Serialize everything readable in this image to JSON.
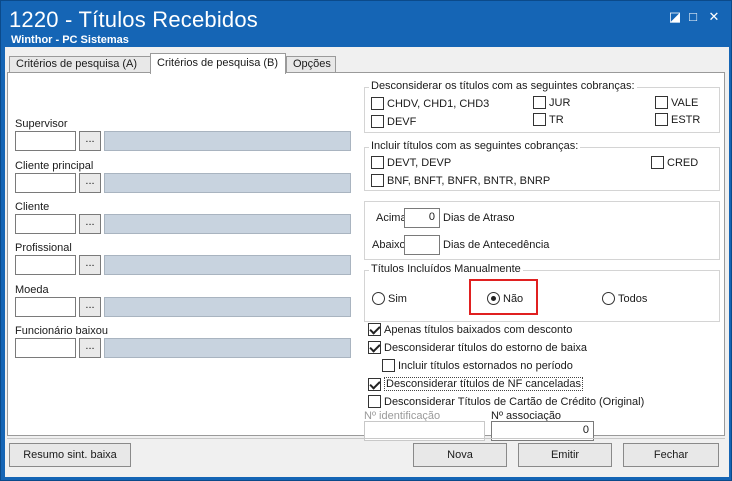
{
  "window": {
    "title": "1220 - Títulos Recebidos",
    "subtitle": "Winthor - PC Sistemas",
    "controls": {
      "restore": "◪",
      "maximize": "□",
      "close": "✕"
    }
  },
  "tabs": [
    {
      "label": "Critérios de pesquisa (A)",
      "active": false
    },
    {
      "label": "Critérios de pesquisa (B)",
      "active": true
    },
    {
      "label": "Opções",
      "active": false
    }
  ],
  "left_fields": {
    "supervisor": {
      "label": "Supervisor",
      "value": "",
      "button": "..."
    },
    "cliente_principal": {
      "label": "Cliente principal",
      "value": "",
      "button": "..."
    },
    "cliente": {
      "label": "Cliente",
      "value": "",
      "button": "..."
    },
    "profissional": {
      "label": "Profissional",
      "value": "",
      "button": "..."
    },
    "moeda": {
      "label": "Moeda",
      "value": "",
      "button": "..."
    },
    "funcionario_baixou": {
      "label": "Funcionário baixou",
      "value": "",
      "button": "..."
    }
  },
  "desconsiderar_cobrancas": {
    "title": "Desconsiderar os títulos com as seguintes cobranças:",
    "items": [
      {
        "label": "CHDV, CHD1, CHD3",
        "checked": false
      },
      {
        "label": "JUR",
        "checked": false
      },
      {
        "label": "VALE",
        "checked": false
      },
      {
        "label": "DEVF",
        "checked": false
      },
      {
        "label": "TR",
        "checked": false
      },
      {
        "label": "ESTR",
        "checked": false
      }
    ]
  },
  "incluir_cobrancas": {
    "title": "Incluir títulos com as seguintes cobranças:",
    "items": [
      {
        "label": "DEVT, DEVP",
        "checked": false
      },
      {
        "label": "CRED",
        "checked": false
      },
      {
        "label": "BNF, BNFT, BNFR, BNTR, BNRP",
        "checked": false
      }
    ]
  },
  "dias": {
    "acima_label": "Acima",
    "acima_value": "0",
    "atraso_label": "Dias de Atraso",
    "abaixo_label": "Abaixo",
    "abaixo_value": "",
    "antecedencia_label": "Dias de Antecedência"
  },
  "manual": {
    "title": "Títulos Incluídos Manualmente",
    "options": [
      {
        "label": "Sim",
        "selected": false
      },
      {
        "label": "Não",
        "selected": true
      },
      {
        "label": "Todos",
        "selected": false
      }
    ],
    "highlight_color": "#e02020"
  },
  "options": [
    {
      "label": "Apenas títulos baixados com desconto",
      "checked": true
    },
    {
      "label": "Desconsiderar títulos do estorno de baixa",
      "checked": true
    },
    {
      "label": "Incluir títulos estornados no período",
      "checked": false
    },
    {
      "label": "Desconsiderar títulos de NF canceladas",
      "checked": true
    },
    {
      "label": "Desconsiderar Títulos de Cartão de Crédito (Original)",
      "checked": false
    }
  ],
  "identificacao": {
    "label": "Nº identificação",
    "value": ""
  },
  "associacao": {
    "label": "Nº associação",
    "value": "0"
  },
  "buttons": {
    "resumo": "Resumo sint. baixa",
    "nova": "Nova",
    "emitir": "Emitir",
    "fechar": "Fechar"
  },
  "colors": {
    "titlebar": "#1565b5",
    "readonly_field": "#c8d3df",
    "highlight": "#e02020"
  }
}
